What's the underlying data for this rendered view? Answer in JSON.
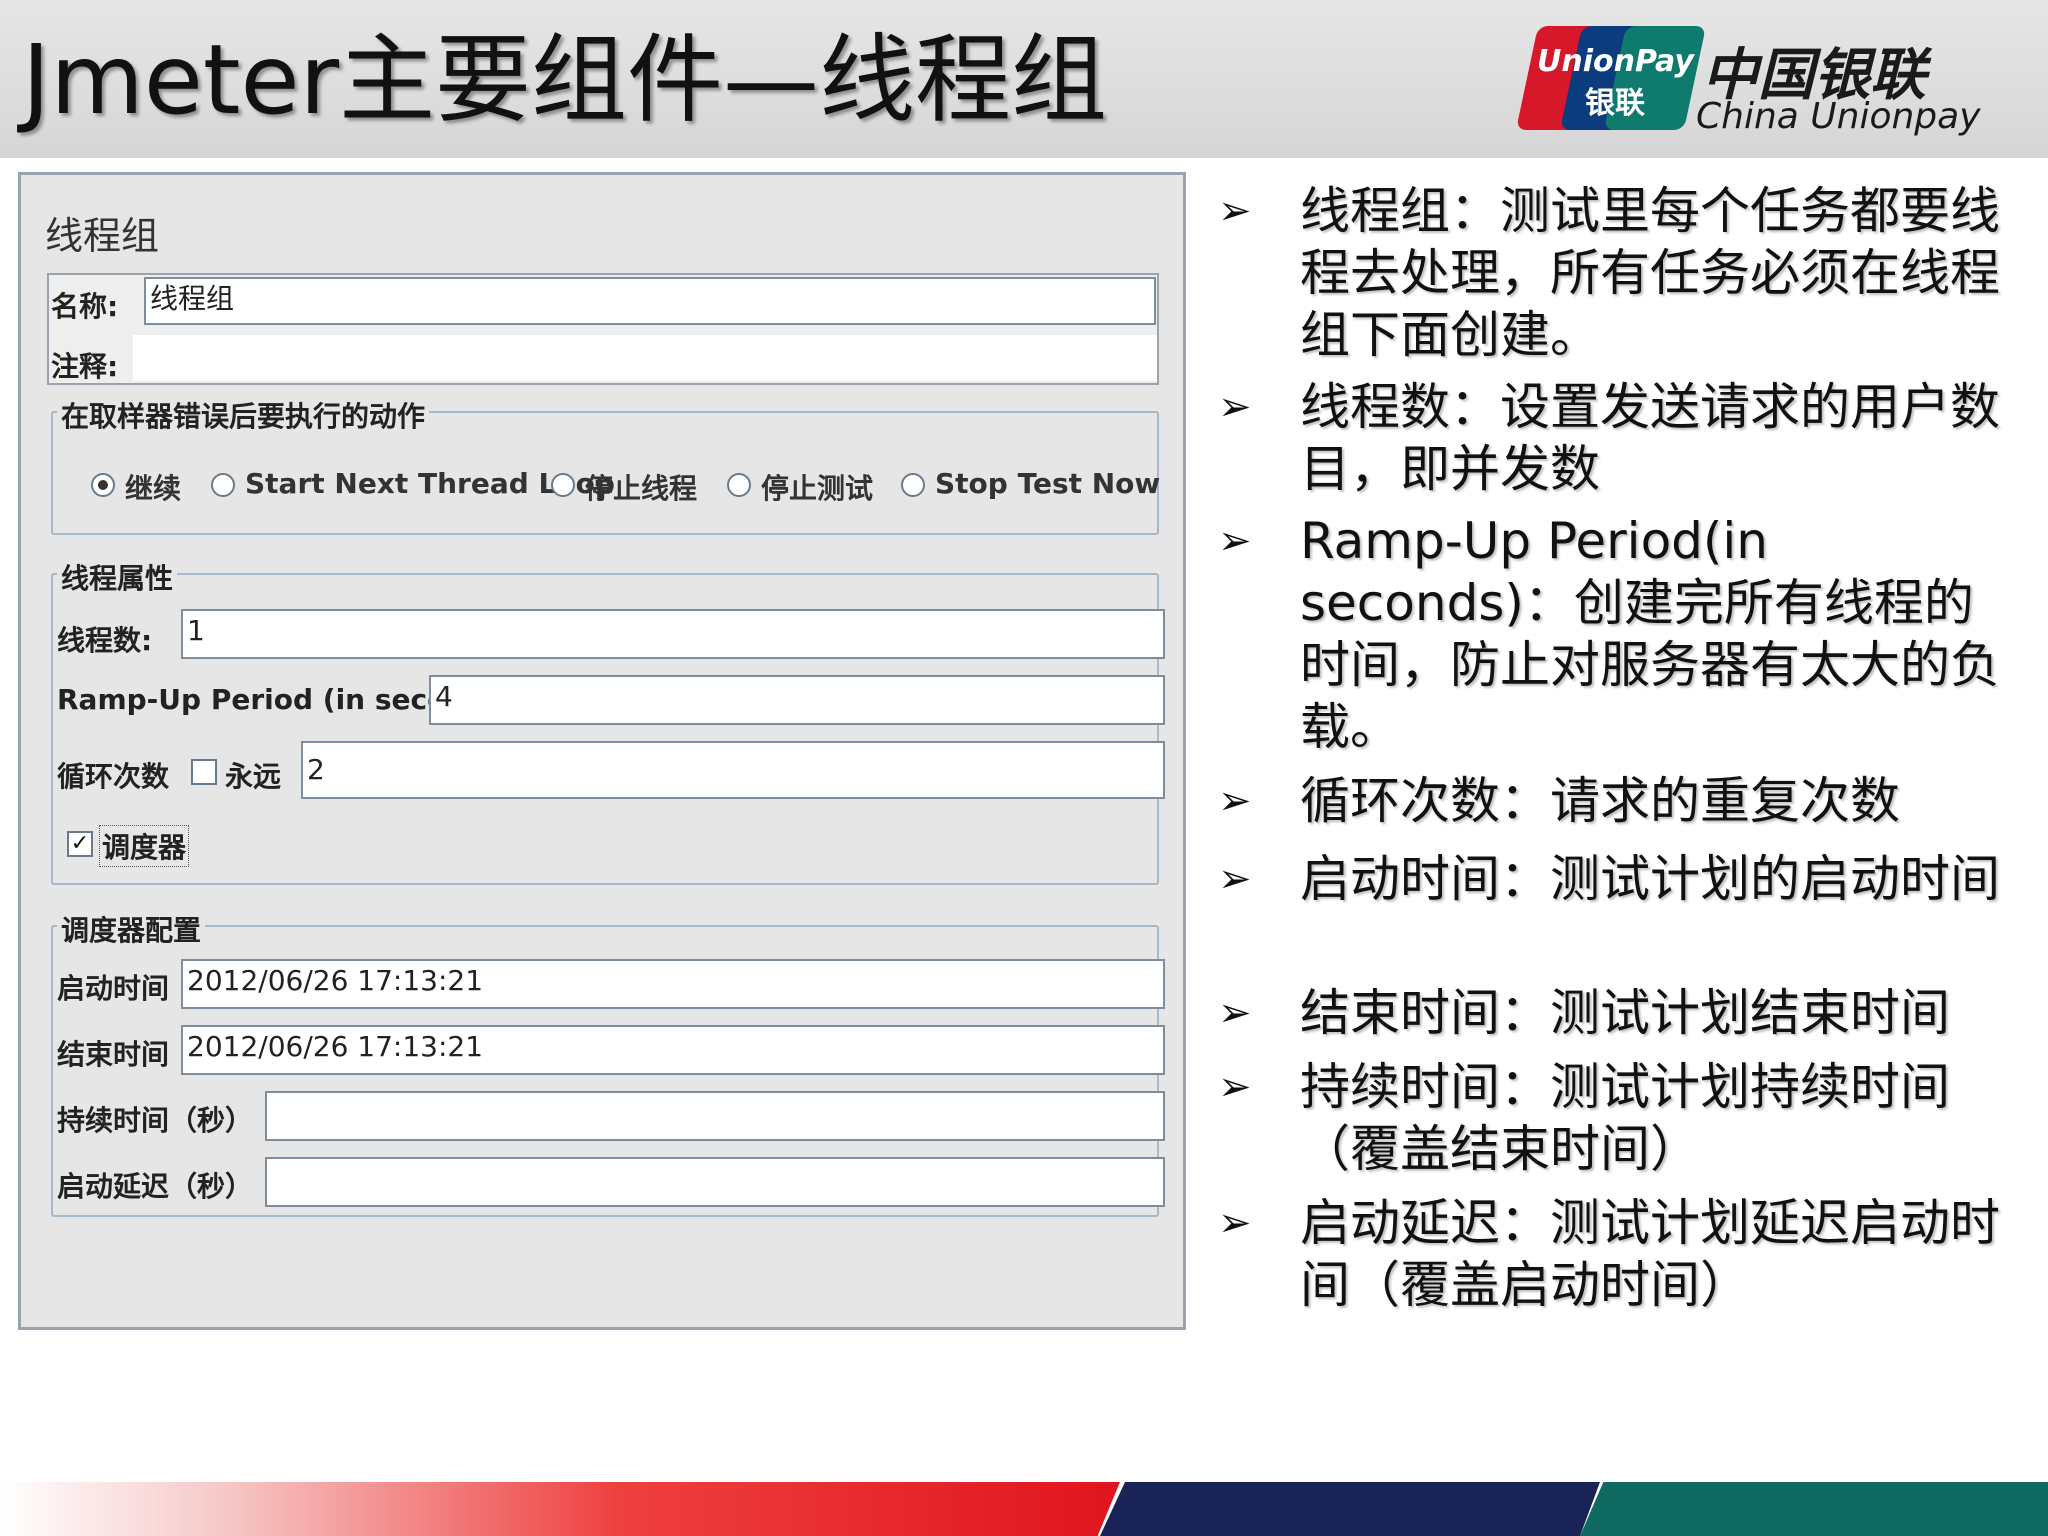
{
  "header": {
    "title": "Jmeter主要组件—线程组",
    "brand_mark_line1": "UnionPay",
    "brand_mark_line2": "银联",
    "brand_cn": "中国银联",
    "brand_en": "China Unionpay"
  },
  "panel": {
    "title": "线程组",
    "name_label": "名称:",
    "name_value": "线程组",
    "comment_label": "注释:",
    "comment_value": "",
    "error_action": {
      "legend": "在取样器错误后要执行的动作",
      "options": [
        "继续",
        "Start Next Thread Loop",
        "停止线程",
        "停止测试",
        "Stop Test Now"
      ],
      "selected": "继续"
    },
    "thread_props": {
      "legend": "线程属性",
      "threads_label": "线程数:",
      "threads_value": "1",
      "rampup_label": "Ramp-Up Period (in seconds):",
      "rampup_value": "4",
      "loop_label": "循环次数",
      "forever_label": "永远",
      "forever_checked": false,
      "loop_value": "2",
      "scheduler_label": "调度器",
      "scheduler_checked": true,
      "check_glyph": "✓"
    },
    "scheduler": {
      "legend": "调度器配置",
      "start_label": "启动时间",
      "start_value": "2012/06/26 17:13:21",
      "end_label": "结束时间",
      "end_value": "2012/06/26 17:13:21",
      "duration_label": "持续时间（秒）",
      "duration_value": "",
      "delay_label": "启动延迟（秒）",
      "delay_value": ""
    }
  },
  "bullet_glyph": "➢",
  "bullets": [
    "线程组：测试里每个任务都要线程去处理，所有任务必须在线程组下面创建。",
    "线程数：设置发送请求的用户数目，即并发数",
    "Ramp-Up Period(in seconds)：创建完所有线程的时间，防止对服务器有太大的负载。",
    "循环次数：请求的重复次数",
    "启动时间：测试计划的启动时间",
    "结束时间：测试计划结束时间",
    "持续时间：测试计划持续时间（覆盖结束时间）",
    "启动延迟：测试计划延迟启动时间（覆盖启动时间）"
  ],
  "colors": {
    "brand_red": "#d7182a",
    "brand_blue": "#0b3c7d",
    "brand_green": "#0f7a6e",
    "footer_navy": "#1a2356",
    "footer_teal": "#0f6b62"
  }
}
